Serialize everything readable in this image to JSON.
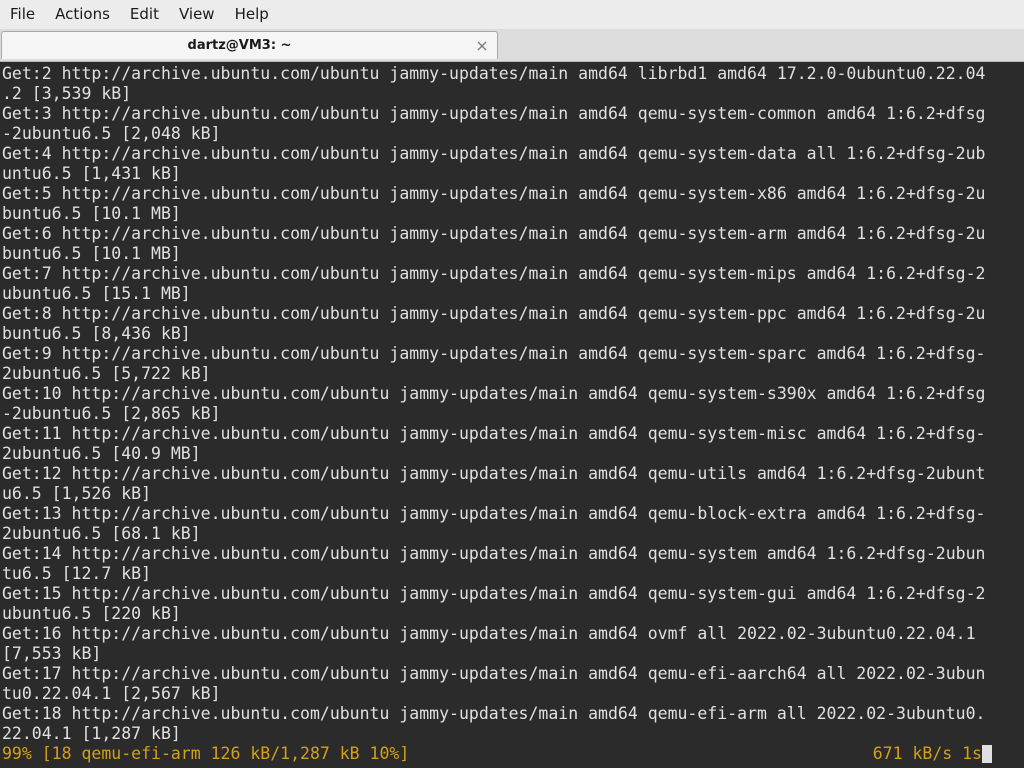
{
  "menubar": {
    "items": [
      "File",
      "Actions",
      "Edit",
      "View",
      "Help"
    ]
  },
  "tab": {
    "title": "dartz@VM3: ~"
  },
  "terminal": {
    "lines": [
      "Get:2 http://archive.ubuntu.com/ubuntu jammy-updates/main amd64 librbd1 amd64 17.2.0-0ubuntu0.22.04",
      ".2 [3,539 kB]",
      "Get:3 http://archive.ubuntu.com/ubuntu jammy-updates/main amd64 qemu-system-common amd64 1:6.2+dfsg",
      "-2ubuntu6.5 [2,048 kB]",
      "Get:4 http://archive.ubuntu.com/ubuntu jammy-updates/main amd64 qemu-system-data all 1:6.2+dfsg-2ub",
      "untu6.5 [1,431 kB]",
      "Get:5 http://archive.ubuntu.com/ubuntu jammy-updates/main amd64 qemu-system-x86 amd64 1:6.2+dfsg-2u",
      "buntu6.5 [10.1 MB]",
      "Get:6 http://archive.ubuntu.com/ubuntu jammy-updates/main amd64 qemu-system-arm amd64 1:6.2+dfsg-2u",
      "buntu6.5 [10.1 MB]",
      "Get:7 http://archive.ubuntu.com/ubuntu jammy-updates/main amd64 qemu-system-mips amd64 1:6.2+dfsg-2",
      "ubuntu6.5 [15.1 MB]",
      "Get:8 http://archive.ubuntu.com/ubuntu jammy-updates/main amd64 qemu-system-ppc amd64 1:6.2+dfsg-2u",
      "buntu6.5 [8,436 kB]",
      "Get:9 http://archive.ubuntu.com/ubuntu jammy-updates/main amd64 qemu-system-sparc amd64 1:6.2+dfsg-",
      "2ubuntu6.5 [5,722 kB]",
      "Get:10 http://archive.ubuntu.com/ubuntu jammy-updates/main amd64 qemu-system-s390x amd64 1:6.2+dfsg",
      "-2ubuntu6.5 [2,865 kB]",
      "Get:11 http://archive.ubuntu.com/ubuntu jammy-updates/main amd64 qemu-system-misc amd64 1:6.2+dfsg-",
      "2ubuntu6.5 [40.9 MB]",
      "Get:12 http://archive.ubuntu.com/ubuntu jammy-updates/main amd64 qemu-utils amd64 1:6.2+dfsg-2ubunt",
      "u6.5 [1,526 kB]",
      "Get:13 http://archive.ubuntu.com/ubuntu jammy-updates/main amd64 qemu-block-extra amd64 1:6.2+dfsg-",
      "2ubuntu6.5 [68.1 kB]",
      "Get:14 http://archive.ubuntu.com/ubuntu jammy-updates/main amd64 qemu-system amd64 1:6.2+dfsg-2ubun",
      "tu6.5 [12.7 kB]",
      "Get:15 http://archive.ubuntu.com/ubuntu jammy-updates/main amd64 qemu-system-gui amd64 1:6.2+dfsg-2",
      "ubuntu6.5 [220 kB]",
      "Get:16 http://archive.ubuntu.com/ubuntu jammy-updates/main amd64 ovmf all 2022.02-3ubuntu0.22.04.1",
      "[7,553 kB]",
      "Get:17 http://archive.ubuntu.com/ubuntu jammy-updates/main amd64 qemu-efi-aarch64 all 2022.02-3ubun",
      "tu0.22.04.1 [2,567 kB]",
      "Get:18 http://archive.ubuntu.com/ubuntu jammy-updates/main amd64 qemu-efi-arm all 2022.02-3ubuntu0.",
      "22.04.1 [1,287 kB]"
    ],
    "status_left": "99% [18 qemu-efi-arm 126 kB/1,287 kB 10%]",
    "status_right": "671 kB/s 1s"
  },
  "colors": {
    "terminal_bg": "#2b2b2b",
    "terminal_fg": "#e0e0e0",
    "status_fg": "#d4a017"
  },
  "icons": {
    "tab_close": "close-icon"
  }
}
